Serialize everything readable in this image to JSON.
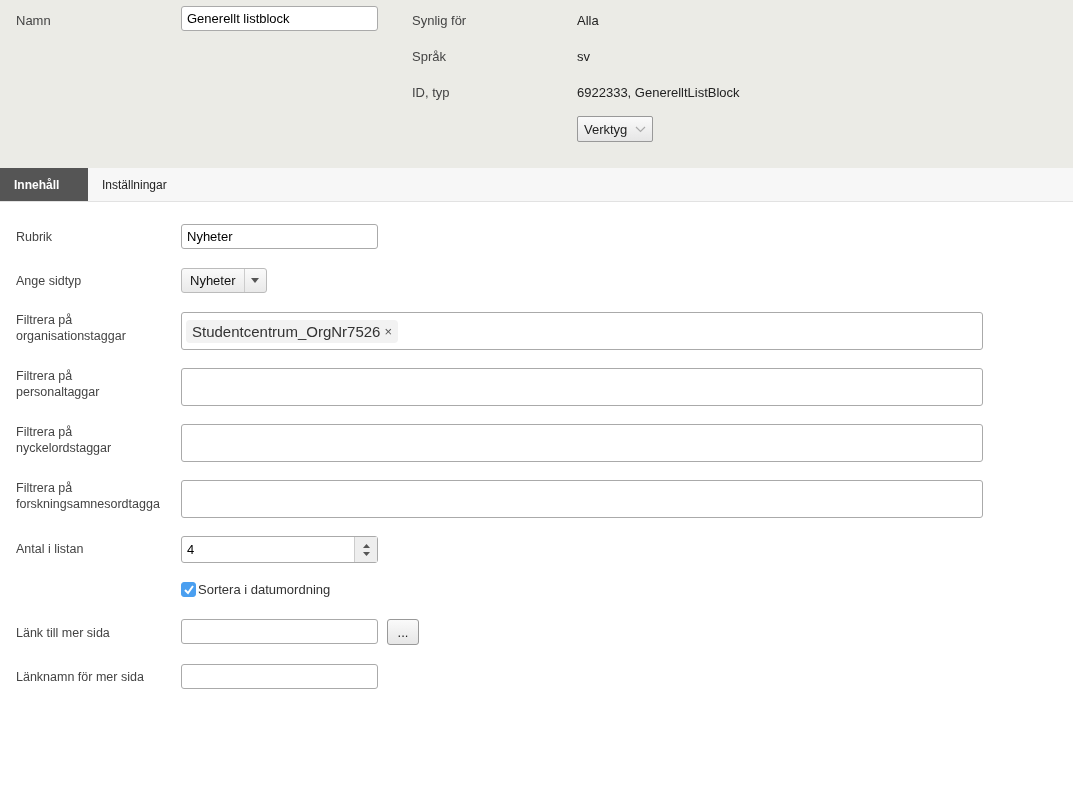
{
  "header": {
    "name_label": "Namn",
    "name_value": "Generellt listblock",
    "meta": [
      {
        "label": "Synlig för",
        "value": "Alla"
      },
      {
        "label": "Språk",
        "value": "sv"
      },
      {
        "label": "ID, typ",
        "value": "6922333, GenerelltListBlock"
      }
    ],
    "tools_button": "Verktyg"
  },
  "tabs": [
    {
      "label": "Innehåll",
      "selected": true
    },
    {
      "label": "Inställningar",
      "selected": false
    }
  ],
  "fields": [
    {
      "kind": "text",
      "label": "Rubrik",
      "value": "Nyheter"
    },
    {
      "kind": "select",
      "label": "Ange sidtyp",
      "value": "Nyheter"
    },
    {
      "kind": "tags",
      "label": "Filtrera på organisationstaggar",
      "tags": [
        {
          "text": "Studentcentrum_OrgNr7526",
          "remove": "×"
        }
      ]
    },
    {
      "kind": "tags",
      "label": "Filtrera på personaltaggar"
    },
    {
      "kind": "tags",
      "label": "Filtrera på nyckelordstaggar"
    },
    {
      "kind": "tags",
      "label": "Filtrera på forskningsamnesordtagga"
    },
    {
      "kind": "number",
      "label": "Antal i listan",
      "value": "4"
    },
    {
      "kind": "checkbox",
      "text": "Sortera i datumordning",
      "checked": true
    },
    {
      "kind": "link",
      "label": "Länk till mer sida",
      "button": "..."
    },
    {
      "kind": "text",
      "label": "Länknamn för mer sida"
    }
  ]
}
